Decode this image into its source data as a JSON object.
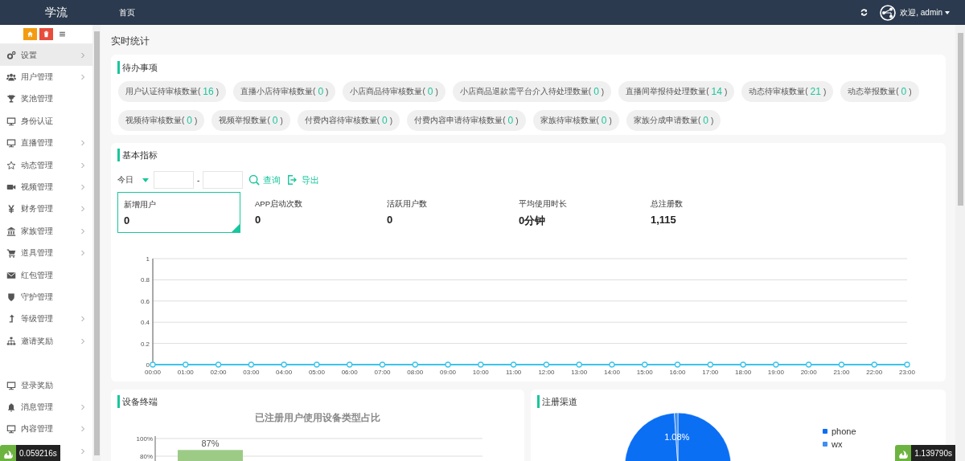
{
  "topbar": {
    "logo": "学流",
    "nav_link": "首页",
    "user": "欢迎, admin"
  },
  "sidebar": {
    "items": [
      {
        "kind": "item",
        "label": "设置",
        "expandable": true,
        "selected": true
      },
      {
        "kind": "item",
        "label": "用户管理",
        "expandable": true,
        "selected": false
      },
      {
        "kind": "item",
        "label": "奖池管理",
        "expandable": false,
        "selected": false
      },
      {
        "kind": "item",
        "label": "身份认证",
        "expandable": false,
        "selected": false
      },
      {
        "kind": "item",
        "label": "直播管理",
        "expandable": true,
        "selected": false
      },
      {
        "kind": "item",
        "label": "动态管理",
        "expandable": true,
        "selected": false
      },
      {
        "kind": "item",
        "label": "视频管理",
        "expandable": true,
        "selected": false
      },
      {
        "kind": "item",
        "label": "财务管理",
        "expandable": true,
        "selected": false
      },
      {
        "kind": "item",
        "label": "家族管理",
        "expandable": true,
        "selected": false
      },
      {
        "kind": "item",
        "label": "道具管理",
        "expandable": true,
        "selected": false
      },
      {
        "kind": "item",
        "label": "红包管理",
        "expandable": false,
        "selected": false
      },
      {
        "kind": "item",
        "label": "守护管理",
        "expandable": false,
        "selected": false
      },
      {
        "kind": "item",
        "label": "等级管理",
        "expandable": true,
        "selected": false
      },
      {
        "kind": "item",
        "label": "邀请奖励",
        "expandable": true,
        "selected": false
      },
      {
        "kind": "blank"
      },
      {
        "kind": "item",
        "label": "登录奖励",
        "expandable": false,
        "selected": false
      },
      {
        "kind": "item",
        "label": "消息管理",
        "expandable": true,
        "selected": false
      },
      {
        "kind": "item",
        "label": "内容管理",
        "expandable": true,
        "selected": false
      },
      {
        "kind": "covered",
        "expandable": true
      }
    ]
  },
  "page_title": "实时统计",
  "todo": {
    "title": "待办事项",
    "items": [
      {
        "label": "用户认证待审核数量(",
        "count": "16",
        "close": ")"
      },
      {
        "label": "直播小店待审核数量(",
        "count": "0",
        "close": ")"
      },
      {
        "label": "小店商品待审核数量(",
        "count": "0",
        "close": ")"
      },
      {
        "label": "小店商品退款需平台介入待处理数量(",
        "count": "0",
        "close": ")"
      },
      {
        "label": "直播间举报待处理数量(",
        "count": "14",
        "close": ")"
      },
      {
        "label": "动态待审核数量(",
        "count": "21",
        "close": ")"
      },
      {
        "label": "动态举报数量(",
        "count": "0",
        "close": ")"
      },
      {
        "label": "视频待审核数量(",
        "count": "0",
        "close": ")"
      },
      {
        "label": "视频举报数量(",
        "count": "0",
        "close": ")"
      },
      {
        "label": "付费内容待审核数量(",
        "count": "0",
        "close": ")"
      },
      {
        "label": "付费内容申请待审核数量(",
        "count": "0",
        "close": ")"
      },
      {
        "label": "家族待审核数量(",
        "count": "0",
        "close": ")"
      },
      {
        "label": "家族分成申请数量(",
        "count": "0",
        "close": ")"
      }
    ]
  },
  "metrics": {
    "title": "基本指标",
    "filter": {
      "period": "今日",
      "separator": "-",
      "search": "查询",
      "export": "导出"
    },
    "tiles": [
      {
        "label": "新增用户",
        "value": "0",
        "selected": true
      },
      {
        "label": "APP启动次数",
        "value": "0",
        "selected": false
      },
      {
        "label": "活跃用户数",
        "value": "0",
        "selected": false
      },
      {
        "label": "平均使用时长",
        "value": "0分钟",
        "selected": false
      },
      {
        "label": "总注册数",
        "value": "1,115",
        "selected": false
      }
    ],
    "chart_data": {
      "type": "line",
      "categories": [
        "00:00",
        "01:00",
        "02:00",
        "03:00",
        "04:00",
        "05:00",
        "06:00",
        "07:00",
        "08:00",
        "09:00",
        "10:00",
        "11:00",
        "12:00",
        "13:00",
        "14:00",
        "15:00",
        "16:00",
        "17:00",
        "18:00",
        "19:00",
        "20:00",
        "21:00",
        "22:00",
        "23:00"
      ],
      "series": [
        {
          "color": "#3cc4ea",
          "marker": true,
          "values": [
            0,
            0,
            0,
            0,
            0,
            0,
            0,
            0,
            0,
            0,
            0,
            0,
            0,
            0,
            0,
            0,
            0,
            0,
            0,
            0,
            0,
            0,
            0,
            0
          ]
        }
      ],
      "ylim": [
        0,
        1
      ],
      "yticks": [
        0,
        0.2,
        0.4,
        0.6,
        0.8,
        1
      ],
      "grid": true
    }
  },
  "device": {
    "title": "设备终端",
    "chart_data": {
      "type": "bar",
      "title": "已注册用户使用设备类型占比",
      "series": [
        {
          "color": "#9ccb86",
          "values": [
            87
          ]
        }
      ],
      "ylim": [
        0,
        100
      ],
      "yticks": [
        {
          "value": 80,
          "label": "80%"
        },
        {
          "value": 100,
          "label": "100%"
        }
      ],
      "value_labels": [
        "87%"
      ]
    }
  },
  "channel": {
    "title": "注册渠道",
    "chart_data": {
      "type": "pie",
      "values": [
        98.92,
        1.08
      ],
      "value_labels": [
        null,
        "1.08%"
      ]
    },
    "legend": [
      {
        "label": "phone",
        "color": "#0b6ff4"
      },
      {
        "label": "wx",
        "color": "#3f8ef3"
      }
    ]
  },
  "debug": [
    "0.059216s",
    "1.139790s"
  ]
}
